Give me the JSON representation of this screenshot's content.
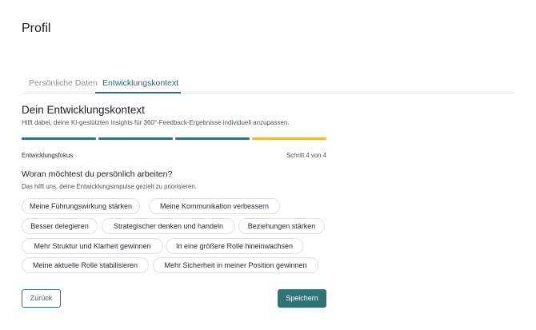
{
  "page": {
    "title": "Profil"
  },
  "tabs": [
    {
      "label": "Persönliche Daten",
      "active": false
    },
    {
      "label": "Entwicklungskontext",
      "active": true
    }
  ],
  "section": {
    "title": "Dein Entwicklungskontext",
    "subtitle": "Hilft dabei, deine KI-gestützten Insights für 360°-Feedback-Ergebnisse individuell anzupassen."
  },
  "progress": {
    "label": "Entwicklungsfokus",
    "step_text": "Schritt 4 von 4",
    "current_step": 4,
    "total_steps": 4,
    "colors": {
      "done": "#2f7472",
      "current": "#f0b93a"
    }
  },
  "question": {
    "title": "Woran möchtest du persönlich arbeiten?",
    "subtitle": "Das hilft uns, deine Entwicklungsimpulse gezielt zu priorisieren."
  },
  "options": [
    "Meine Führungswirkung stärken",
    "Meine Kommunikation verbessern",
    "Besser delegieren",
    "Strategischer denken und handeln",
    "Beziehungen stärken",
    "Mehr Struktur und Klarheit gewinnen",
    "In eine größere Rolle hineinwachsen",
    "Meine aktuelle Rolle stabilisieren",
    "Mehr Sicherheit in meiner Position gewinnen"
  ],
  "actions": {
    "back_label": "Zurück",
    "save_label": "Speichern"
  },
  "colors": {
    "accent": "#2f7472",
    "warning": "#f0b93a"
  }
}
